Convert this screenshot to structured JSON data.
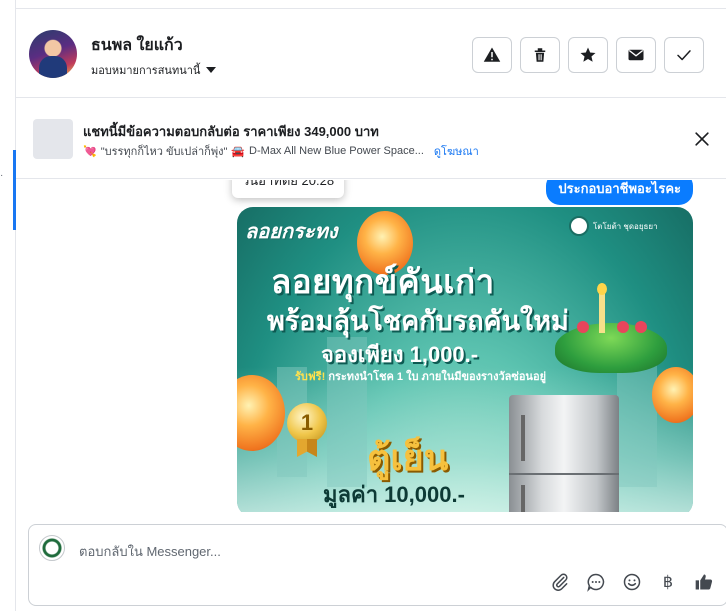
{
  "contact": {
    "name": "ธนพล ใยแก้ว",
    "assign_label": "มอบหมายการสนทนานี้"
  },
  "actions": [
    {
      "name": "report-spam-button",
      "icon": "warning-icon"
    },
    {
      "name": "delete-button",
      "icon": "trash-icon"
    },
    {
      "name": "star-button",
      "icon": "star-icon"
    },
    {
      "name": "mark-unread-button",
      "icon": "envelope-icon"
    },
    {
      "name": "mark-done-button",
      "icon": "check-icon"
    }
  ],
  "ad": {
    "title": "แชทนี้มีข้อความตอบกลับต่อ ราคาเพียง 349,000 บาท",
    "emoji1": "💘",
    "quote": "\"บรรทุกก็ไหว ขับเปล่าก็พุ่ง\"",
    "emoji2": "🚘",
    "model": "D-Max All New Blue Power Space...",
    "link": "ดูโฆษณา"
  },
  "messages": {
    "tooltip": "วันอาทิตย์ 20:28",
    "outgoing": "ประกอบอาชีพอะไรคะ"
  },
  "promo": {
    "brand_tag": "ลอยกระทง",
    "logo_text": "โตโยต้า ชุดอยุธยา",
    "line1": "ลอยทุกข์คันเก่า",
    "line2": "พร้อมลุ้นโชคกับรถคันใหม่",
    "line3": "จองเพียง 1,000.-",
    "bonus_highlight": "รับฟรี!",
    "bonus_rest": "กระทงนำโชค 1 ใบ ภายในมีของรางวัลซ่อนอยู่",
    "medal_number": "1",
    "prize": "ตู้เย็น",
    "value": "มูลค่า 10,000.-"
  },
  "composer": {
    "placeholder": "ตอบกลับใน Messenger..."
  },
  "composer_tools": [
    {
      "name": "attach-icon"
    },
    {
      "name": "saved-replies-icon"
    },
    {
      "name": "emoji-icon"
    },
    {
      "name": "baht-payment-icon",
      "glyph": "฿"
    },
    {
      "name": "thumbs-up-icon"
    }
  ],
  "colors": {
    "accent": "#1877f2",
    "bubble": "#0a7cff",
    "border": "#ccd0d5"
  }
}
